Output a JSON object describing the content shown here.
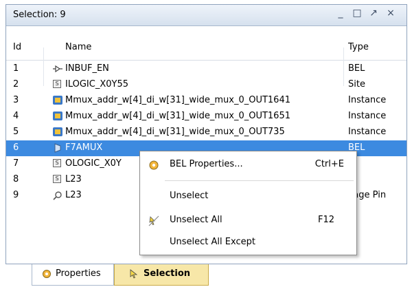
{
  "window": {
    "title": "Selection: 9",
    "controls": [
      "minimize",
      "maximize",
      "float",
      "close"
    ]
  },
  "columns": {
    "id": "Id",
    "name": "Name",
    "type": "Type"
  },
  "rows": [
    {
      "id": "1",
      "icon": "input-buffer-icon",
      "name": "INBUF_EN",
      "type": "BEL"
    },
    {
      "id": "2",
      "icon": "site-icon",
      "name": "ILOGIC_X0Y55",
      "type": "Site"
    },
    {
      "id": "3",
      "icon": "instance-icon",
      "name": "Mmux_addr_w[4]_di_w[31]_wide_mux_0_OUT1641",
      "type": "Instance"
    },
    {
      "id": "4",
      "icon": "instance-icon",
      "name": "Mmux_addr_w[4]_di_w[31]_wide_mux_0_OUT1651",
      "type": "Instance"
    },
    {
      "id": "5",
      "icon": "instance-icon",
      "name": "Mmux_addr_w[4]_di_w[31]_wide_mux_0_OUT735",
      "type": "Instance"
    },
    {
      "id": "6",
      "icon": "mux-icon",
      "name": "F7AMUX",
      "type": "BEL",
      "selected": true
    },
    {
      "id": "7",
      "icon": "site-icon",
      "name": "OLOGIC_X0Y",
      "type": ""
    },
    {
      "id": "8",
      "icon": "site-icon",
      "name": "L23",
      "type": ""
    },
    {
      "id": "9",
      "icon": "package-pin-icon",
      "name": "L23",
      "type": "kage Pin"
    }
  ],
  "context_menu": {
    "items": [
      {
        "label": "BEL Properties...",
        "shortcut": "Ctrl+E",
        "icon": "properties-icon"
      },
      {
        "label": "Unselect",
        "shortcut": ""
      },
      {
        "label": "Unselect All",
        "shortcut": "F12",
        "icon": "unselect-all-icon"
      },
      {
        "label": "Unselect All Except",
        "shortcut": ""
      }
    ]
  },
  "tabs": [
    {
      "label": "Properties",
      "active": false,
      "icon": "properties-tab-icon"
    },
    {
      "label": "Selection",
      "active": true,
      "icon": "cursor-tab-icon"
    }
  ]
}
